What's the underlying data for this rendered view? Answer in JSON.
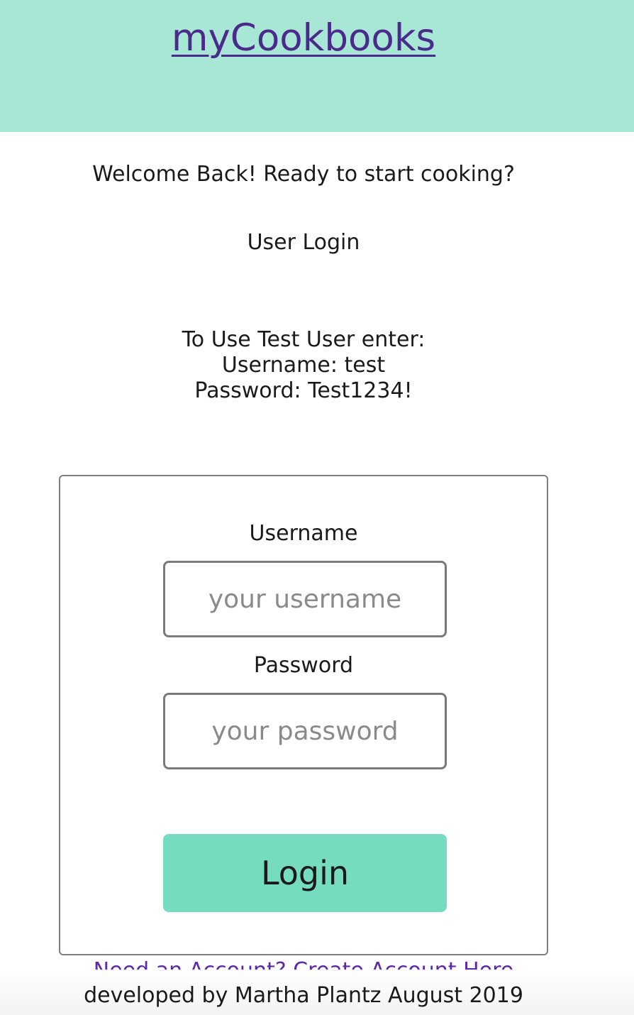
{
  "header": {
    "brand": "myCookbooks"
  },
  "intro": {
    "welcome": "Welcome Back! Ready to start cooking?",
    "heading": "User Login"
  },
  "test_user": {
    "line1": "To Use Test User enter:",
    "line2": "Username: test",
    "line3": "Password: Test1234!"
  },
  "form": {
    "username_label": "Username",
    "username_placeholder": "your username",
    "username_value": "",
    "password_label": "Password",
    "password_placeholder": "your password",
    "password_value": "",
    "login_label": "Login"
  },
  "links": {
    "create_account": "Need an Account? Create Account Here"
  },
  "footer": {
    "credit": "developed by Martha Plantz August 2019"
  },
  "colors": {
    "header_bg": "#a8e7d6",
    "button_bg": "#75dcc0",
    "link": "#4a2a8a"
  }
}
